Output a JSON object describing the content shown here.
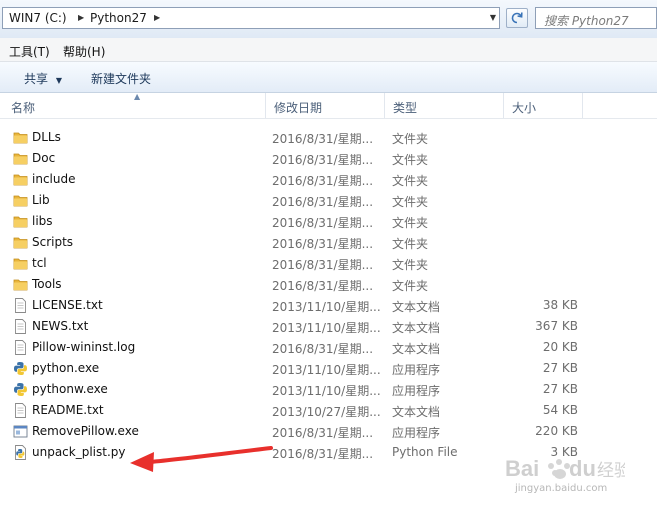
{
  "address_bar": {
    "breadcrumbs": [
      "WIN7 (C:)",
      "Python27"
    ],
    "search_placeholder": "搜索 Python27"
  },
  "menu": {
    "items": [
      "工具(T)",
      "帮助(H)"
    ]
  },
  "command_bar": {
    "share_label": "共享",
    "new_folder_label": "新建文件夹"
  },
  "columns": {
    "name": "名称",
    "modified": "修改日期",
    "type": "类型",
    "size": "大小"
  },
  "files": [
    {
      "name": "DLLs",
      "modified": "2016/8/31/星期...",
      "type": "文件夹",
      "size": "",
      "icon": "folder-icon"
    },
    {
      "name": "Doc",
      "modified": "2016/8/31/星期...",
      "type": "文件夹",
      "size": "",
      "icon": "folder-icon"
    },
    {
      "name": "include",
      "modified": "2016/8/31/星期...",
      "type": "文件夹",
      "size": "",
      "icon": "folder-icon"
    },
    {
      "name": "Lib",
      "modified": "2016/8/31/星期...",
      "type": "文件夹",
      "size": "",
      "icon": "folder-icon"
    },
    {
      "name": "libs",
      "modified": "2016/8/31/星期...",
      "type": "文件夹",
      "size": "",
      "icon": "folder-icon"
    },
    {
      "name": "Scripts",
      "modified": "2016/8/31/星期...",
      "type": "文件夹",
      "size": "",
      "icon": "folder-icon"
    },
    {
      "name": "tcl",
      "modified": "2016/8/31/星期...",
      "type": "文件夹",
      "size": "",
      "icon": "folder-icon"
    },
    {
      "name": "Tools",
      "modified": "2016/8/31/星期...",
      "type": "文件夹",
      "size": "",
      "icon": "folder-icon"
    },
    {
      "name": "LICENSE.txt",
      "modified": "2013/11/10/星期...",
      "type": "文本文档",
      "size": "38 KB",
      "icon": "text-file-icon"
    },
    {
      "name": "NEWS.txt",
      "modified": "2013/11/10/星期...",
      "type": "文本文档",
      "size": "367 KB",
      "icon": "text-file-icon"
    },
    {
      "name": "Pillow-wininst.log",
      "modified": "2016/8/31/星期...",
      "type": "文本文档",
      "size": "20 KB",
      "icon": "text-file-icon"
    },
    {
      "name": "python.exe",
      "modified": "2013/11/10/星期...",
      "type": "应用程序",
      "size": "27 KB",
      "icon": "python-icon"
    },
    {
      "name": "pythonw.exe",
      "modified": "2013/11/10/星期...",
      "type": "应用程序",
      "size": "27 KB",
      "icon": "python-icon"
    },
    {
      "name": "README.txt",
      "modified": "2013/10/27/星期...",
      "type": "文本文档",
      "size": "54 KB",
      "icon": "text-file-icon"
    },
    {
      "name": "RemovePillow.exe",
      "modified": "2016/8/31/星期...",
      "type": "应用程序",
      "size": "220 KB",
      "icon": "application-icon"
    },
    {
      "name": "unpack_plist.py",
      "modified": "2016/8/31/星期...",
      "type": "Python File",
      "size": "3 KB",
      "icon": "python-script-icon"
    }
  ],
  "watermark": {
    "site": "jingyan.baidu.com"
  },
  "colors": {
    "annotation_arrow": "#e8302c",
    "folder": "#e8b53c",
    "command_text": "#1e395b"
  }
}
